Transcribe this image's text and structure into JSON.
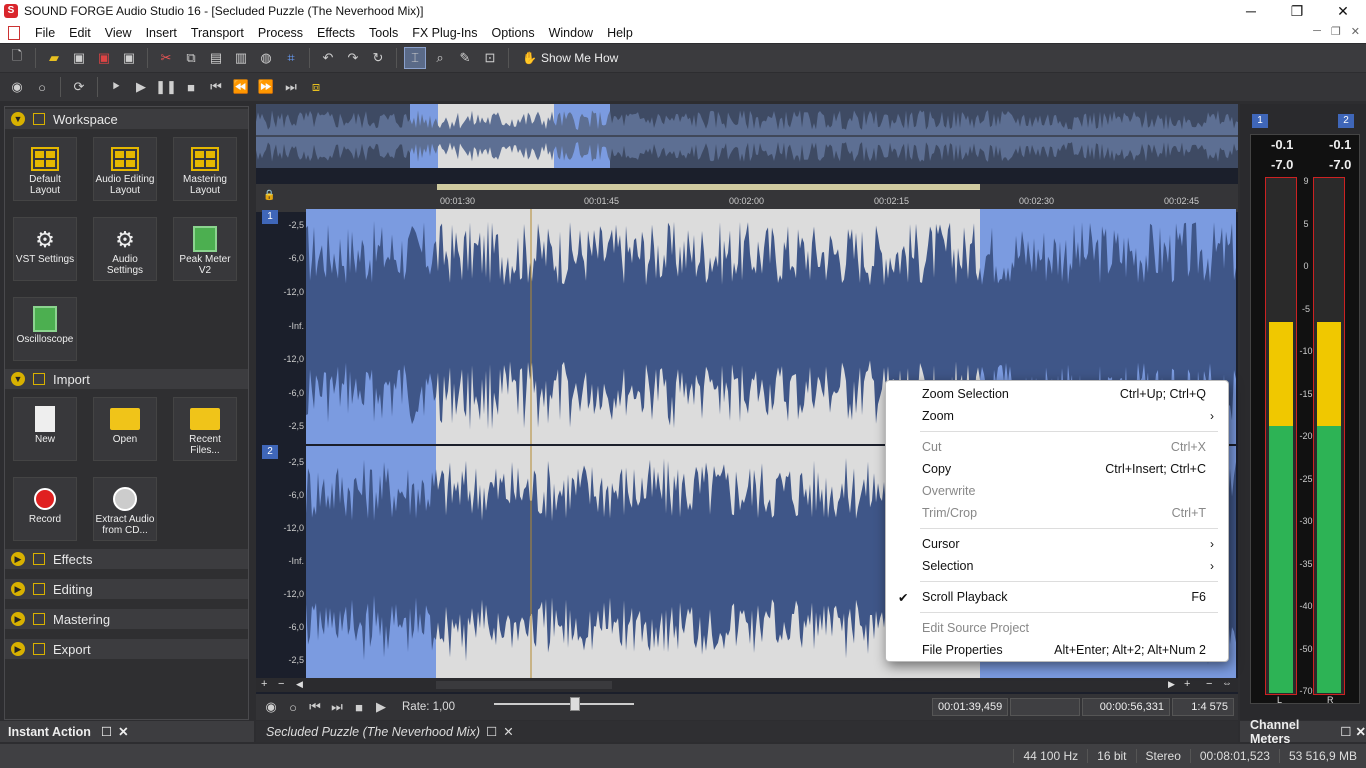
{
  "window": {
    "title": "SOUND FORGE Audio Studio 16 - [Secluded Puzzle (The Neverhood Mix)]",
    "app_icon": "S",
    "minimize": "─",
    "restore": "❐",
    "close": "✕"
  },
  "menu": [
    "File",
    "Edit",
    "View",
    "Insert",
    "Transport",
    "Process",
    "Effects",
    "Tools",
    "FX Plug-Ins",
    "Options",
    "Window",
    "Help"
  ],
  "toolbar": {
    "show_me_how": "Show Me How"
  },
  "workspace": {
    "sections": {
      "workspace": "Workspace",
      "import": "Import",
      "effects": "Effects",
      "editing": "Editing",
      "mastering": "Mastering",
      "export": "Export"
    },
    "tiles": {
      "default_layout": "Default Layout",
      "audio_editing_layout": "Audio Editing Layout",
      "mastering_layout": "Mastering Layout",
      "vst_settings": "VST Settings",
      "audio_settings": "Audio Settings",
      "peak_meter": "Peak Meter V2",
      "oscilloscope": "Oscilloscope",
      "new": "New",
      "open": "Open",
      "recent_files": "Recent Files...",
      "record": "Record",
      "extract_audio": "Extract Audio from CD..."
    },
    "footer": "Instant Action"
  },
  "ruler": [
    "00:01:30",
    "00:01:45",
    "00:02:00",
    "00:02:15",
    "00:02:30",
    "00:02:45"
  ],
  "tracks": [
    {
      "num": "1"
    },
    {
      "num": "2"
    }
  ],
  "db_labels": [
    "-2,5",
    "-6,0",
    "-12,0",
    "-Inf.",
    "-12,0",
    "-6,0",
    "-2,5"
  ],
  "transport": {
    "rate": "Rate: 1,00",
    "position": "00:01:39,459",
    "length": "00:00:56,331",
    "zoom": "1:4 575"
  },
  "document_tab": "Secluded Puzzle (The Neverhood Mix)",
  "meters": {
    "title": "Channel Meters",
    "ch1": "1",
    "ch2": "2",
    "peak_l": "-0.1",
    "peak_r": "-0.1",
    "rms_l": "-7.0",
    "rms_r": "-7.0",
    "l": "L",
    "r": "R",
    "scale": [
      "9",
      "5",
      "0",
      "-5",
      "-10",
      "-15",
      "-20",
      "-25",
      "-30",
      "-35",
      "-40",
      "-50",
      "-70"
    ],
    "level_l": 0.72,
    "level_r": 0.72
  },
  "status": [
    "44 100 Hz",
    "16 bit",
    "Stereo",
    "00:08:01,523",
    "53 516,9 MB"
  ],
  "context_menu": [
    {
      "label": "Zoom Selection",
      "shortcut": "Ctrl+Up; Ctrl+Q",
      "enabled": true
    },
    {
      "label": "Zoom",
      "submenu": true,
      "enabled": true
    },
    {
      "label": "Cut",
      "shortcut": "Ctrl+X",
      "enabled": false
    },
    {
      "label": "Copy",
      "shortcut": "Ctrl+Insert; Ctrl+C",
      "enabled": true
    },
    {
      "label": "Overwrite",
      "enabled": false
    },
    {
      "label": "Trim/Crop",
      "shortcut": "Ctrl+T",
      "enabled": false
    },
    {
      "label": "Cursor",
      "submenu": true,
      "enabled": true
    },
    {
      "label": "Selection",
      "submenu": true,
      "enabled": true
    },
    {
      "label": "Scroll Playback",
      "shortcut": "F6",
      "checked": true,
      "enabled": true
    },
    {
      "label": "Edit Source Project",
      "enabled": false
    },
    {
      "label": "File Properties",
      "shortcut": "Alt+Enter; Alt+2; Alt+Num 2",
      "enabled": true
    }
  ]
}
